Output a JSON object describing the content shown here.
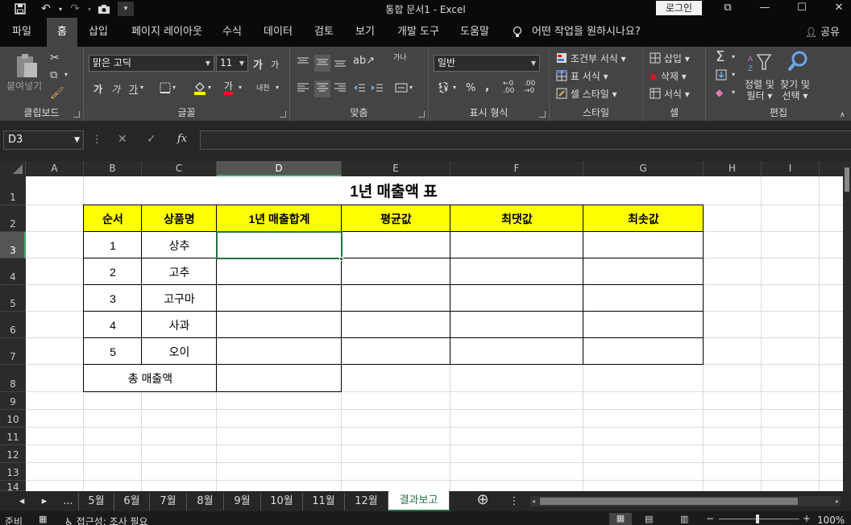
{
  "window": {
    "title": "통합 문서1  -  Excel",
    "login_label": "로그인",
    "minimize": "—",
    "maximize": "☐",
    "close": "✕",
    "restore": "⧉"
  },
  "tabs": [
    "파일",
    "홈",
    "삽입",
    "페이지 레이아웃",
    "수식",
    "데이터",
    "검토",
    "보기",
    "개발 도구",
    "도움말"
  ],
  "tell_me": "어떤 작업을 원하시나요?",
  "share_label": "공유",
  "ribbon": {
    "clipboard": {
      "label": "클립보드",
      "paste": "붙여넣기"
    },
    "font": {
      "label": "글꼴",
      "name": "맑은 고딕",
      "size": "11",
      "grow": "가",
      "shrink": "가",
      "bold": "가",
      "italic": "가",
      "underline": "가",
      "color": "가",
      "phonetic": "내천"
    },
    "align": {
      "label": "맞춤",
      "wrap": "가나"
    },
    "number": {
      "label": "표시 형식",
      "format": "일반",
      "percent": "%",
      "comma": ","
    },
    "styles": {
      "label": "스타일",
      "cond": "조건부 서식",
      "table": "표 서식",
      "cell": "셀 스타일"
    },
    "cells": {
      "label": "셀",
      "insert": "삽입",
      "delete": "삭제",
      "format": "서식"
    },
    "edit": {
      "label": "편집",
      "sort": "정렬 및",
      "sort2": "필터",
      "find": "찾기 및",
      "find2": "선택"
    }
  },
  "formula_bar": {
    "name_box": "D3",
    "fx": "fx",
    "value": ""
  },
  "columns": [
    "A",
    "B",
    "C",
    "D",
    "E",
    "F",
    "G",
    "H",
    "I"
  ],
  "rows": [
    "1",
    "2",
    "3",
    "4",
    "5",
    "6",
    "7",
    "8",
    "9",
    "10",
    "11",
    "12",
    "13",
    "14"
  ],
  "sheet": {
    "title": "1년 매출액 표",
    "headers": [
      "순서",
      "상품명",
      "1년 매출합계",
      "평균값",
      "최댓값",
      "최솟값"
    ],
    "items": [
      {
        "no": "1",
        "name": "상추"
      },
      {
        "no": "2",
        "name": "고추"
      },
      {
        "no": "3",
        "name": "고구마"
      },
      {
        "no": "4",
        "name": "사과"
      },
      {
        "no": "5",
        "name": "오이"
      }
    ],
    "total_label": "총 매출액"
  },
  "sheet_tabs": [
    "...",
    "5월",
    "6월",
    "7월",
    "8월",
    "9월",
    "10월",
    "11월",
    "12월",
    "결과보고"
  ],
  "active_sheet": "결과보고",
  "status": {
    "ready": "준비",
    "accessibility": "접근성: 조사 필요",
    "zoom": "100%"
  }
}
